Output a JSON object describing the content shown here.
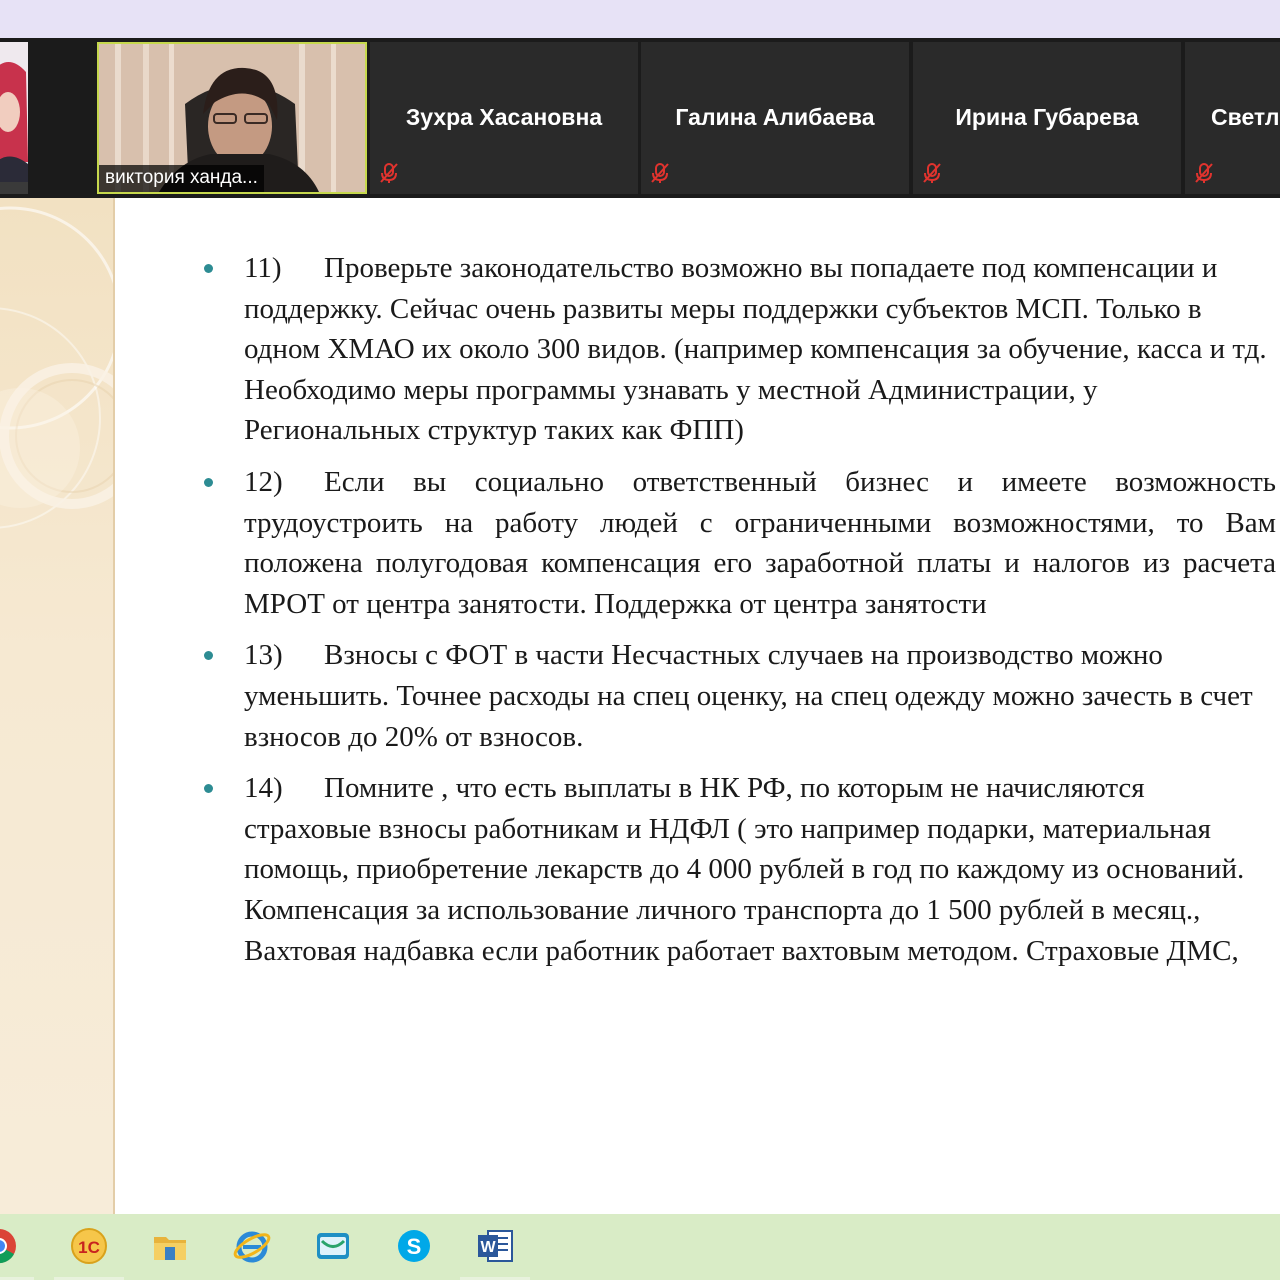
{
  "meeting": {
    "participants": [
      {
        "name": ""
      },
      {
        "name": "виктория ханда..."
      },
      {
        "name": "Зухра Хасановна"
      },
      {
        "name": "Галина Алибаева"
      },
      {
        "name": "Ирина Губарева"
      },
      {
        "name": "Светл"
      }
    ]
  },
  "slide": {
    "items": [
      {
        "num": "11)",
        "text": "Проверьте законодательство возможно вы попадаете под компенсации и поддержку. Сейчас очень развиты меры поддержки субъектов МСП. Только в одном ХМАО их около 300 видов. (например  компенсация за обучение, касса  и тд. Необходимо меры программы узнавать у местной Администрации, у Региональных структур таких как ФПП)"
      },
      {
        "num": "12)",
        "text": "Если вы социально ответственный бизнес и имеете возможность трудоустроить  на работу людей с ограниченными возможностями, то Вам положена полугодовая компенсация его заработной платы и налогов из расчета МРОТ от центра занятости. Поддержка от центра занятости"
      },
      {
        "num": "13)",
        "text": "Взносы с ФОТ в части Несчастных случаев на производство можно уменьшить. Точнее расходы на спец оценку, на спец одежду можно зачесть в счет взносов до 20% от взносов."
      },
      {
        "num": "14)",
        "text": "Помните , что есть выплаты в НК РФ,  по которым не начисляются страховые взносы работникам и НДФЛ ( это например подарки, материальная помощь, приобретение лекарств  до 4 000 рублей в год по каждому из оснований. Компенсация за использование личного транспорта до 1 500 рублей в месяц., Вахтовая надбавка если работник работает вахтовым методом. Страховые ДМС,"
      }
    ],
    "bullet_color": "#2d8c93"
  },
  "taskbar": {
    "apps": [
      {
        "icon": "chrome-icon"
      },
      {
        "icon": "1c-icon",
        "label": "1С"
      },
      {
        "icon": "file-explorer-icon"
      },
      {
        "icon": "internet-explorer-icon"
      },
      {
        "icon": "mail-icon"
      },
      {
        "icon": "skype-icon",
        "label": "S"
      },
      {
        "icon": "word-icon",
        "label": "W"
      }
    ],
    "background": "#d9ecc6"
  },
  "colors": {
    "gallery_bg": "#1b1b1b",
    "active_speaker_border": "#c6d84d",
    "muted_mic": "#e0332e"
  }
}
